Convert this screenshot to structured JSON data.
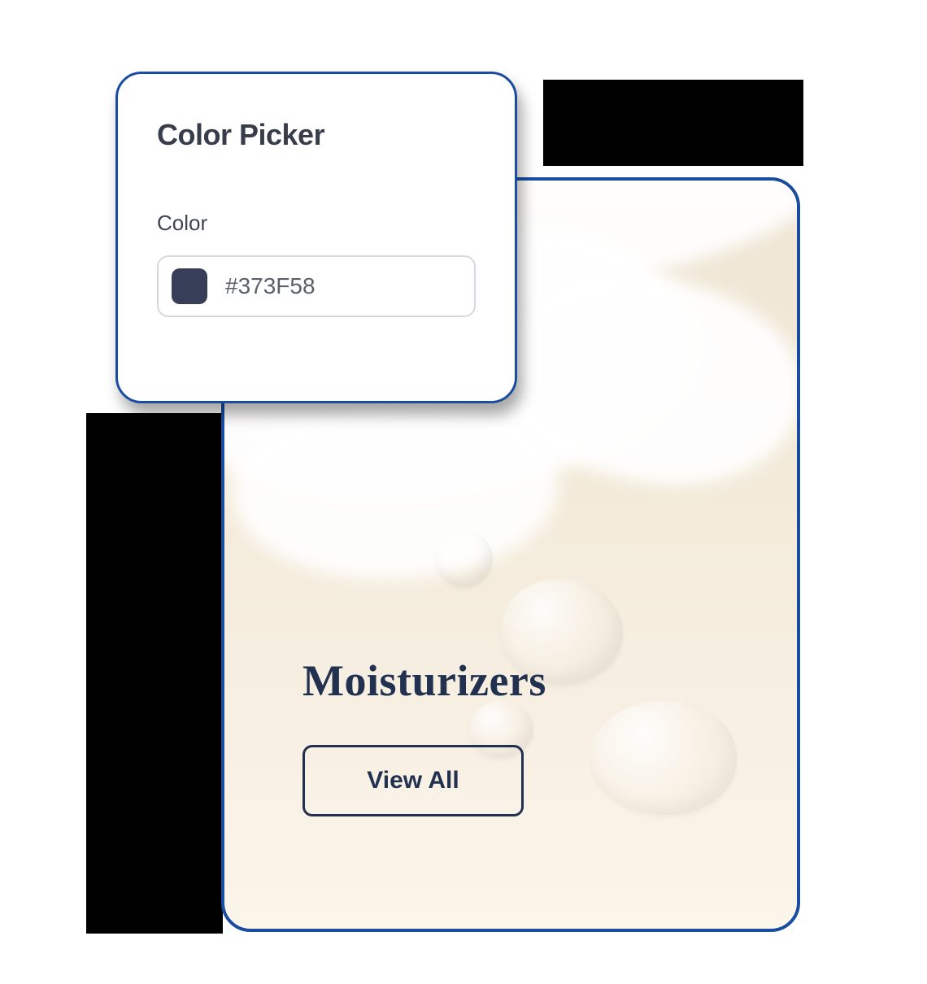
{
  "picker": {
    "title": "Color Picker",
    "label": "Color",
    "value": "#373F58",
    "swatch_color": "#373F58"
  },
  "hero": {
    "title": "Moisturizers",
    "button_label": "View All"
  },
  "colors": {
    "accent_border": "#194da0",
    "text_dark": "#22314f"
  }
}
